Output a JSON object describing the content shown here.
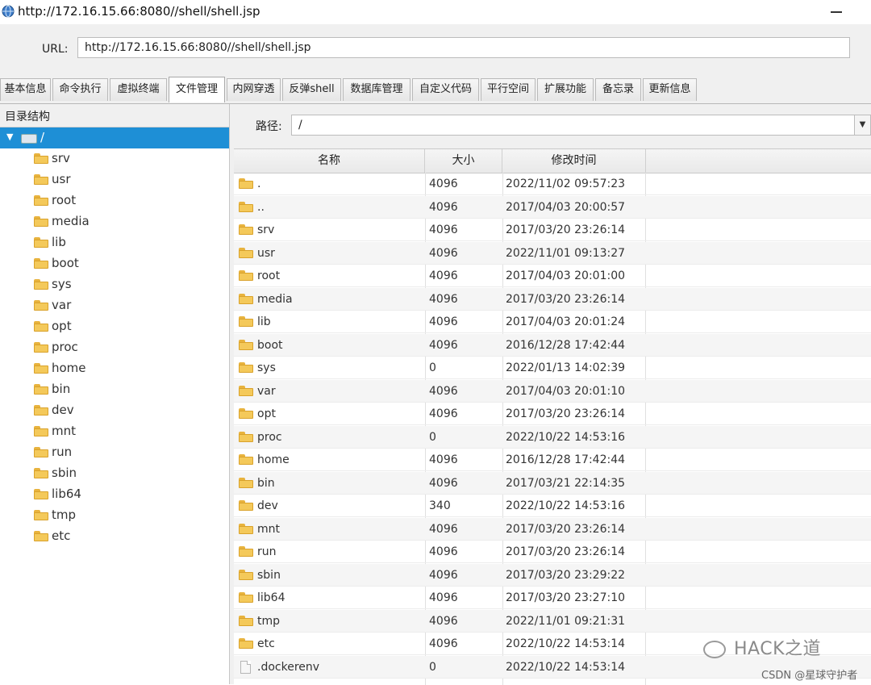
{
  "window": {
    "title": "http://172.16.15.66:8080//shell/shell.jsp"
  },
  "urlbar": {
    "label": "URL:",
    "value": "http://172.16.15.66:8080//shell/shell.jsp"
  },
  "tabs": [
    {
      "label": "基本信息"
    },
    {
      "label": "命令执行"
    },
    {
      "label": "虚拟终端"
    },
    {
      "label": "文件管理",
      "active": true
    },
    {
      "label": "内网穿透"
    },
    {
      "label": "反弹shell"
    },
    {
      "label": "数据库管理"
    },
    {
      "label": "自定义代码"
    },
    {
      "label": "平行空间"
    },
    {
      "label": "扩展功能"
    },
    {
      "label": "备忘录"
    },
    {
      "label": "更新信息"
    }
  ],
  "tree": {
    "header": "目录结构",
    "root": "/",
    "items": [
      "srv",
      "usr",
      "root",
      "media",
      "lib",
      "boot",
      "sys",
      "var",
      "opt",
      "proc",
      "home",
      "bin",
      "dev",
      "mnt",
      "run",
      "sbin",
      "lib64",
      "tmp",
      "etc"
    ]
  },
  "path": {
    "label": "路径:",
    "value": "/"
  },
  "table": {
    "columns": [
      "名称",
      "大小",
      "修改时间"
    ],
    "rows": [
      {
        "name": ".",
        "size": "4096",
        "mtime": "2022/11/02 09:57:23",
        "type": "folder"
      },
      {
        "name": "..",
        "size": "4096",
        "mtime": "2017/04/03 20:00:57",
        "type": "folder"
      },
      {
        "name": "srv",
        "size": "4096",
        "mtime": "2017/03/20 23:26:14",
        "type": "folder"
      },
      {
        "name": "usr",
        "size": "4096",
        "mtime": "2022/11/01 09:13:27",
        "type": "folder"
      },
      {
        "name": "root",
        "size": "4096",
        "mtime": "2017/04/03 20:01:00",
        "type": "folder"
      },
      {
        "name": "media",
        "size": "4096",
        "mtime": "2017/03/20 23:26:14",
        "type": "folder"
      },
      {
        "name": "lib",
        "size": "4096",
        "mtime": "2017/04/03 20:01:24",
        "type": "folder"
      },
      {
        "name": "boot",
        "size": "4096",
        "mtime": "2016/12/28 17:42:44",
        "type": "folder"
      },
      {
        "name": "sys",
        "size": "0",
        "mtime": "2022/01/13 14:02:39",
        "type": "folder"
      },
      {
        "name": "var",
        "size": "4096",
        "mtime": "2017/04/03 20:01:10",
        "type": "folder"
      },
      {
        "name": "opt",
        "size": "4096",
        "mtime": "2017/03/20 23:26:14",
        "type": "folder"
      },
      {
        "name": "proc",
        "size": "0",
        "mtime": "2022/10/22 14:53:16",
        "type": "folder"
      },
      {
        "name": "home",
        "size": "4096",
        "mtime": "2016/12/28 17:42:44",
        "type": "folder"
      },
      {
        "name": "bin",
        "size": "4096",
        "mtime": "2017/03/21 22:14:35",
        "type": "folder"
      },
      {
        "name": "dev",
        "size": "340",
        "mtime": "2022/10/22 14:53:16",
        "type": "folder"
      },
      {
        "name": "mnt",
        "size": "4096",
        "mtime": "2017/03/20 23:26:14",
        "type": "folder"
      },
      {
        "name": "run",
        "size": "4096",
        "mtime": "2017/03/20 23:26:14",
        "type": "folder"
      },
      {
        "name": "sbin",
        "size": "4096",
        "mtime": "2017/03/20 23:29:22",
        "type": "folder"
      },
      {
        "name": "lib64",
        "size": "4096",
        "mtime": "2017/03/20 23:27:10",
        "type": "folder"
      },
      {
        "name": "tmp",
        "size": "4096",
        "mtime": "2022/11/01 09:21:31",
        "type": "folder"
      },
      {
        "name": "etc",
        "size": "4096",
        "mtime": "2022/10/22 14:53:14",
        "type": "folder"
      },
      {
        "name": ".dockerenv",
        "size": "0",
        "mtime": "2022/10/22 14:53:14",
        "type": "file"
      }
    ]
  },
  "watermark": {
    "text": "HACK之道",
    "credit": "CSDN @星球守护者"
  }
}
